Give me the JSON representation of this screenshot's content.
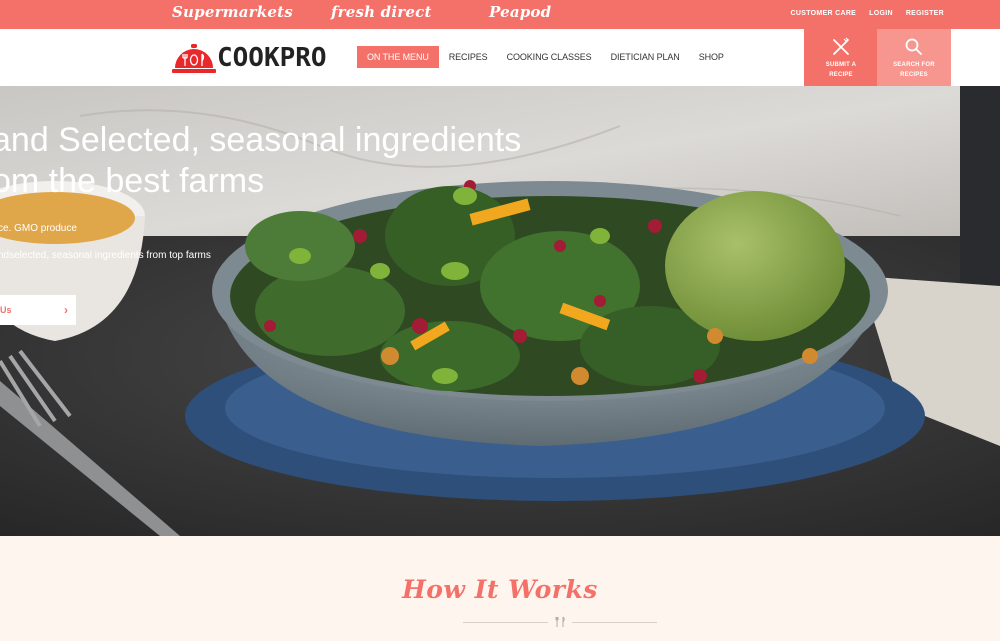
{
  "partners": [
    "Supermarkets",
    "fresh direct",
    "Peapod"
  ],
  "top_links": {
    "customer_care": "CUSTOMER CARE",
    "login": "LOGIN",
    "register": "REGISTER"
  },
  "brand": {
    "name": "COOKPRO"
  },
  "nav": [
    {
      "label": "ON THE MENU",
      "active": true
    },
    {
      "label": "RECIPES"
    },
    {
      "label": "COOKING CLASSES"
    },
    {
      "label": "DIETICIAN PLAN"
    },
    {
      "label": "SHOP"
    }
  ],
  "actions": {
    "submit": {
      "line1": "SUBMIT A",
      "line2": "RECIPE",
      "icon": "utensils-cross-icon"
    },
    "search": {
      "line1": "SEARCH FOR",
      "line2": "RECIPES",
      "icon": "search-icon"
    }
  },
  "hero": {
    "title_line1": "and Selected, seasonal ingredients",
    "title_line2": "om the best farms",
    "bullet1": "ce. GMO produce",
    "bullet2": "ndselected, seasonal ingredients from top farms",
    "cta_label": "Us"
  },
  "how_it_works": {
    "title": "How It Works"
  },
  "colors": {
    "accent": "#f47169",
    "accent_light": "#f7968e",
    "cream": "#fdf5ee"
  }
}
